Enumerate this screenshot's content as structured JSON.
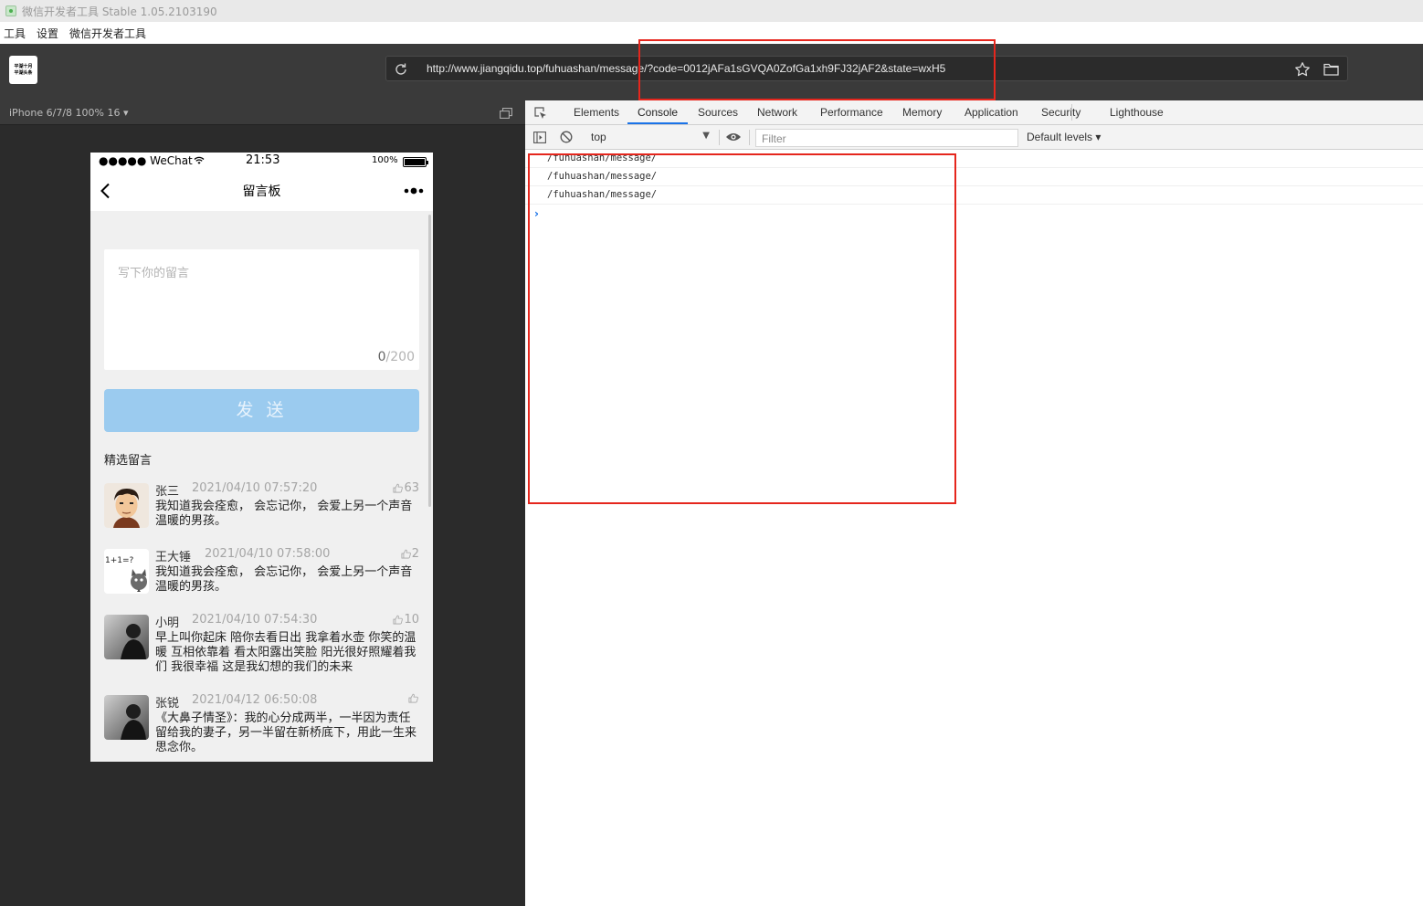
{
  "window": {
    "title": "微信开发者工具 Stable 1.05.2103190"
  },
  "menu": [
    "工具",
    "设置",
    "微信开发者工具"
  ],
  "toolbar": {
    "logo_lines": [
      "平湖十月",
      "平湖头条"
    ],
    "url": "http://www.jiangqidu.top/fuhuashan/message/?code=0012jAFa1sGVQA0ZofGa1xh9FJ32jAF2&state=wxH5"
  },
  "simulator": {
    "device_label": "iPhone 6/7/8 100% 16 ▾",
    "status": {
      "carrier": "●●●●● WeChat",
      "time": "21:53",
      "battery": "100%",
      "battery_level": 1.0
    },
    "nav_title": "留言板",
    "message_input": {
      "placeholder": "写下你的留言",
      "count_current": "0",
      "count_max": "/200"
    },
    "send_label": "发 送",
    "section_title": "精选留言",
    "comments": [
      {
        "name": "张三",
        "time": "2021/04/10 07:57:20",
        "likes": "63",
        "text": "我知道我会痊愈， 会忘记你， 会爱上另一个声音温暖的男孩。",
        "avatar": "cartoon-boy-avatar"
      },
      {
        "name": "王大锤",
        "time": "2021/04/10 07:58:00",
        "likes": "2",
        "text": "我知道我会痊愈， 会忘记你， 会爱上另一个声音温暖的男孩。",
        "avatar": "cat-math-avatar",
        "avatar_text": "1+1=?"
      },
      {
        "name": "小明",
        "time": "2021/04/10 07:54:30",
        "likes": "10",
        "text": "早上叫你起床 陪你去看日出 我拿着水壶 你笑的温暖 互相依靠着 看太阳露出笑脸 阳光很好照耀着我们 我很幸福 这是我幻想的我们的未来",
        "avatar": "dark-photo-avatar"
      },
      {
        "name": "张锐",
        "time": "2021/04/12 06:50:08",
        "likes": "",
        "text": "《大鼻子情圣》：我的心分成两半，一半因为责任留给我的妻子，另一半留在新桥底下，用此一生来思念你。",
        "avatar": "dark-photo-avatar"
      }
    ]
  },
  "devtools": {
    "tabs": [
      "Elements",
      "Console",
      "Sources",
      "Network",
      "Performance",
      "Memory",
      "Application",
      "Security",
      "Lighthouse"
    ],
    "active_tab": "Console",
    "context": "top",
    "filter_placeholder": "Filter",
    "levels": "Default levels ▾",
    "logs": [
      "/fuhuashan/message/",
      "/fuhuashan/message/",
      "/fuhuashan/message/"
    ],
    "prompt": "›"
  },
  "colors": {
    "accent": "#1a73e8",
    "annotation": "#e5261d",
    "send_button": "#9bcbef"
  }
}
